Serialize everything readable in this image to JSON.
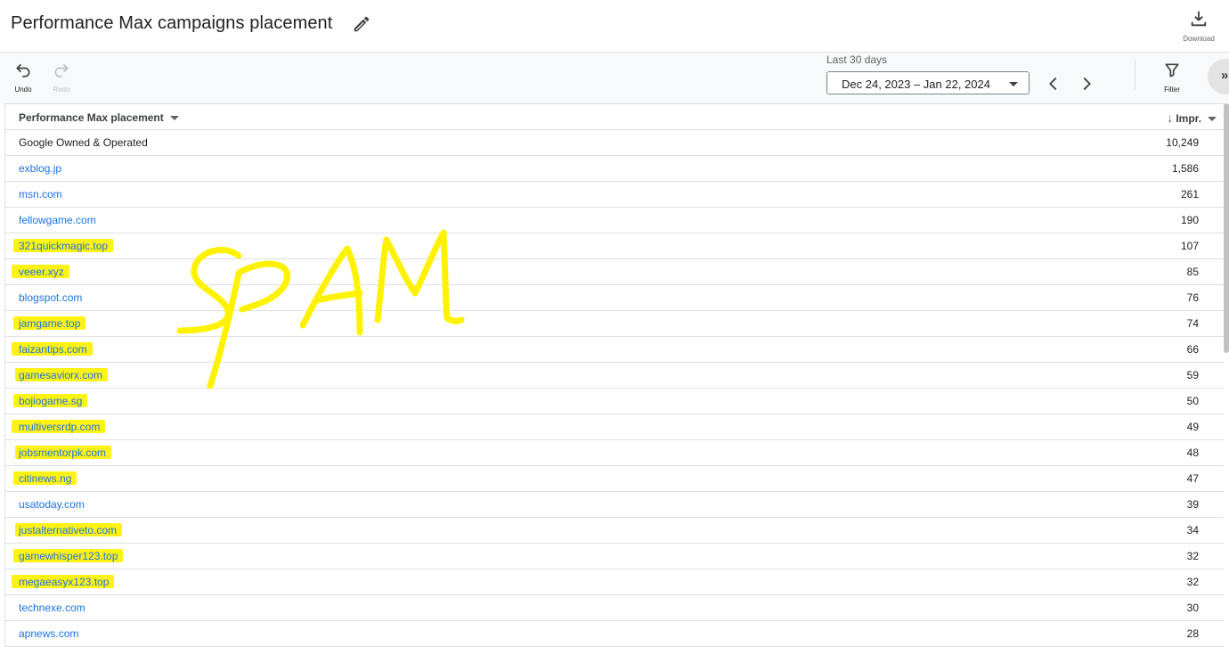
{
  "header": {
    "title": "Performance Max campaigns placement",
    "download_label": "Download"
  },
  "toolbar": {
    "undo_label": "Undo",
    "redo_label": "Redo",
    "date_caption": "Last 30 days",
    "date_range": "Dec 24, 2023 – Jan 22, 2024",
    "filter_label": "Filter"
  },
  "table": {
    "col_placement": "Performance Max placement",
    "col_impr": "Impr.",
    "rows": [
      {
        "name": "Google Owned & Operated",
        "impr": "10,249",
        "link": false,
        "highlight": false
      },
      {
        "name": "exblog.jp",
        "impr": "1,586",
        "link": true,
        "highlight": false
      },
      {
        "name": "msn.com",
        "impr": "261",
        "link": true,
        "highlight": false
      },
      {
        "name": "fellowgame.com",
        "impr": "190",
        "link": true,
        "highlight": false
      },
      {
        "name": "321quickmagic.top",
        "impr": "107",
        "link": true,
        "highlight": true
      },
      {
        "name": "veeer.xyz",
        "impr": "85",
        "link": true,
        "highlight": true
      },
      {
        "name": "blogspot.com",
        "impr": "76",
        "link": true,
        "highlight": false
      },
      {
        "name": "jamgame.top",
        "impr": "74",
        "link": true,
        "highlight": true
      },
      {
        "name": "faizantips.com",
        "impr": "66",
        "link": true,
        "highlight": true
      },
      {
        "name": "gamesaviorx.com",
        "impr": "59",
        "link": true,
        "highlight": true
      },
      {
        "name": "bojiogame.sg",
        "impr": "50",
        "link": true,
        "highlight": true
      },
      {
        "name": "multiversrdp.com",
        "impr": "49",
        "link": true,
        "highlight": true
      },
      {
        "name": "jobsmentorpk.com",
        "impr": "48",
        "link": true,
        "highlight": true
      },
      {
        "name": "citinews.ng",
        "impr": "47",
        "link": true,
        "highlight": true
      },
      {
        "name": "usatoday.com",
        "impr": "39",
        "link": true,
        "highlight": false
      },
      {
        "name": "justalternativeto.com",
        "impr": "34",
        "link": true,
        "highlight": true
      },
      {
        "name": "gamewhisper123.top",
        "impr": "32",
        "link": true,
        "highlight": true
      },
      {
        "name": "megaeasyx123.top",
        "impr": "32",
        "link": true,
        "highlight": true
      },
      {
        "name": "technexe.com",
        "impr": "30",
        "link": true,
        "highlight": false
      },
      {
        "name": "apnews.com",
        "impr": "28",
        "link": true,
        "highlight": false
      }
    ]
  },
  "annotation": {
    "text": "SPAM",
    "highlight_color": "#fff200",
    "link_color": "#1a73e8"
  }
}
